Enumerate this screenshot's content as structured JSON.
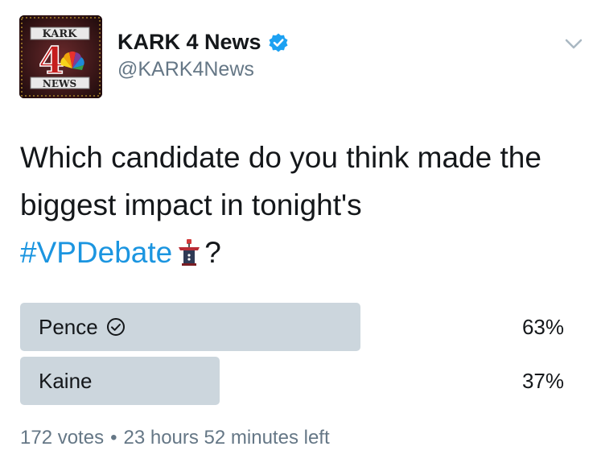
{
  "account": {
    "display_name": "KARK 4 News",
    "handle": "@KARK4News",
    "verified_icon": "verified-badge-icon",
    "avatar": {
      "top_text": "KARK",
      "number": "4",
      "bottom_text": "NEWS"
    }
  },
  "tweet": {
    "text_before_hashtag": "Which candidate do you think made the biggest impact in tonight's",
    "hashtag": "#VPDebate",
    "emoji": "podium-emoji-icon",
    "text_after": "?"
  },
  "poll": {
    "options": [
      {
        "label": "Pence",
        "percent_text": "63%",
        "percent": 63,
        "winner": true
      },
      {
        "label": "Kaine",
        "percent_text": "37%",
        "percent": 37,
        "winner": false
      }
    ],
    "votes": "172 votes",
    "separator": "•",
    "time_left": "23 hours 52 minutes left"
  },
  "colors": {
    "text": "#14171a",
    "secondary": "#657786",
    "link": "#1b95e0",
    "verified": "#1da1f2",
    "poll_bar": "#ccd6dd"
  }
}
